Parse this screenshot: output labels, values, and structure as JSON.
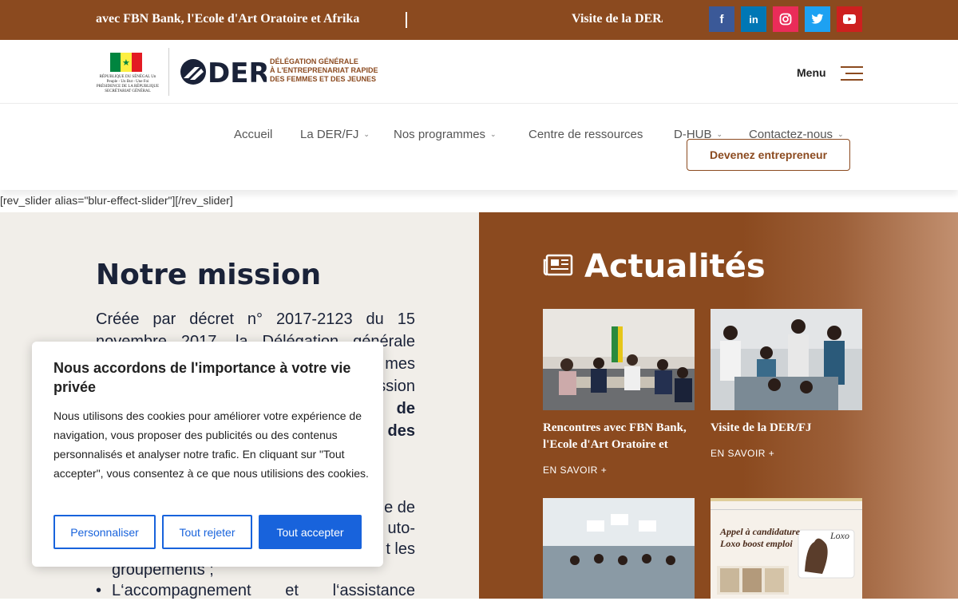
{
  "ticker": {
    "item_1": "avec FBN Bank, l'Ecole d'Art Oratoire et Afrika",
    "item_2": "Visite de la DER/FJ"
  },
  "social": [
    {
      "icon": "facebook-icon",
      "glyph": "f",
      "color": "#3B5998"
    },
    {
      "icon": "linkedin-icon",
      "glyph": "in",
      "color": "#0077B5"
    },
    {
      "icon": "instagram-icon",
      "glyph": "◎",
      "color": "#EA2C59"
    },
    {
      "icon": "twitter-icon",
      "glyph": "t",
      "color": "#1DA1F2"
    },
    {
      "icon": "youtube-icon",
      "glyph": "▶",
      "color": "#CD201F"
    }
  ],
  "header": {
    "flag_caption": "RÉPUBLIQUE DU SÉNÉGAL Un Peuple - Un But - Une Foi PRÉSIDENCE DE LA RÉPUBLIQUE SECRÉTARIAT GÉNÉRAL",
    "logo_text": "DER",
    "logo_subtitle_1": "DÉLÉGATION GÉNÉRALE",
    "logo_subtitle_2": "À L'ENTREPRENARIAT RAPIDE",
    "logo_subtitle_3": "DES FEMMES ET DES JEUNES",
    "menu_label": "Menu"
  },
  "nav": {
    "items": [
      {
        "label": "Accueil",
        "dropdown": false
      },
      {
        "label": "La DER/FJ",
        "dropdown": true
      },
      {
        "label": "Nos programmes",
        "dropdown": true
      },
      {
        "label": "Centre de ressources",
        "dropdown": false
      },
      {
        "label": "D-HUB",
        "dropdown": true
      },
      {
        "label": "Contactez-nous",
        "dropdown": true
      }
    ],
    "cta": "Devenez entrepreneur"
  },
  "shortcode": "[rev_slider alias=\"blur-effect-slider\"][/rev_slider]",
  "mission": {
    "title": "Notre mission",
    "body_lines": [
      "Créée par décret n° 2017-2123 du 15",
      "novembre 2017, la Délégation générale",
      "mes",
      "ssion",
      "de",
      "des"
    ],
    "list_lines": [
      "e de",
      "uto-",
      "t les",
      "groupements ;",
      "L‘accompagnement et l‘assistance"
    ]
  },
  "news": {
    "title": "Actualités",
    "more_label": "EN SAVOIR +",
    "cards": [
      {
        "title": "Rencontres avec FBN Bank, l'Ecole d'Art Oratoire et"
      },
      {
        "title": "Visite de la DER/FJ"
      },
      {
        "title": ""
      },
      {
        "title": "",
        "poster_title": "Appel à candidature",
        "poster_subtitle": "Loxo boost emploi",
        "poster_brand": "Loxo"
      }
    ]
  },
  "cookie": {
    "title": "Nous accordons de l'importance à votre vie privée",
    "text": "Nous utilisons des cookies pour améliorer votre expérience de navigation, vous proposer des publicités ou des contenus personnalisés et analyser notre trafic. En cliquant sur \"Tout accepter\", vous consentez à ce que nous utilisions des cookies.",
    "btn_customize": "Personnaliser",
    "btn_reject": "Tout rejeter",
    "btn_accept": "Tout accepter"
  },
  "colors": {
    "brand": "#8B4A1F",
    "navy": "#1A2238",
    "cookie_blue": "#1863DC"
  }
}
